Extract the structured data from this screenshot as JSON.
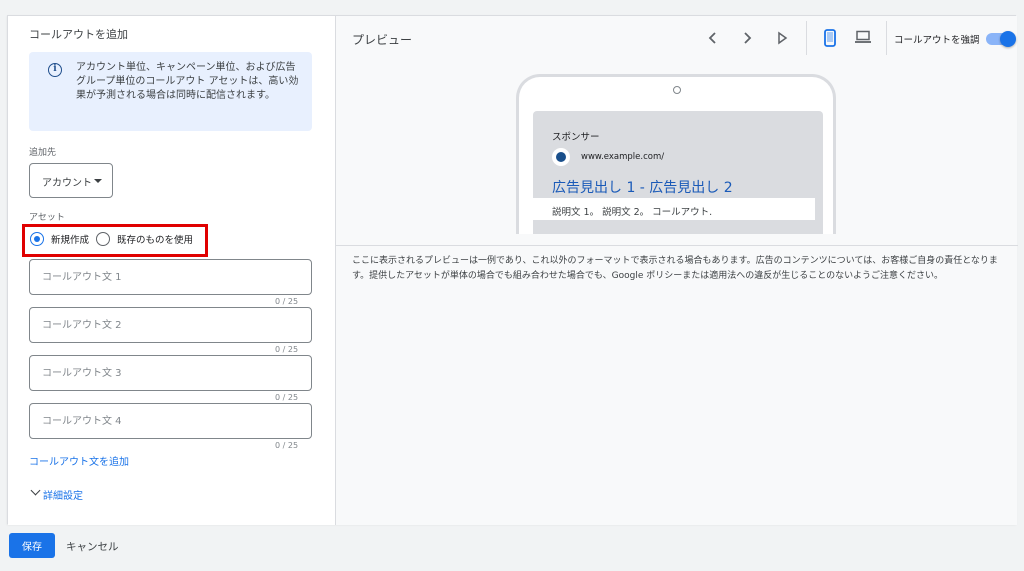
{
  "left_panel": {
    "title": "コールアウトを追加",
    "info_text": "アカウント単位、キャンペーン単位、および広告グループ単位のコールアウト アセットは、高い効果が予測される場合は同時に配信されます。",
    "add_to_label": "追加先",
    "add_to_value": "アカウント",
    "assets_label": "アセット",
    "radio_new": "新規作成",
    "radio_existing": "既存のものを使用",
    "fields": [
      {
        "placeholder": "コールアウト文 1",
        "value": "",
        "counter": "0 / 25"
      },
      {
        "placeholder": "コールアウト文 2",
        "value": "",
        "counter": "0 / 25"
      },
      {
        "placeholder": "コールアウト文 3",
        "value": "",
        "counter": "0 / 25"
      },
      {
        "placeholder": "コールアウト文 4",
        "value": "",
        "counter": "0 / 25"
      }
    ],
    "add_link": "コールアウト文を追加",
    "advanced_link": "詳細設定"
  },
  "preview": {
    "title": "プレビュー",
    "toolbar": {
      "prev_icon": "chevron-left-icon",
      "next_icon": "chevron-right-icon",
      "play_icon": "play-icon",
      "mobile_icon": "mobile-icon",
      "desktop_icon": "laptop-icon"
    },
    "highlight_toggle_label": "コールアウトを強調",
    "highlight_toggle_on": true,
    "ad": {
      "sponsor": "スポンサー",
      "url": "www.example.com/",
      "headline": "広告見出し 1 - 広告見出し 2",
      "description": "説明文 1。 説明文 2。 コールアウト."
    },
    "disclaimer": "ここに表示されるプレビューは一例であり、これ以外のフォーマットで表示される場合もあります。広告のコンテンツについては、お客様ご自身の責任となります。提供したアセットが単体の場合でも組み合わせた場合でも、Google ポリシーまたは適用法への違反が生じることのないようご注意ください。"
  },
  "footer": {
    "save_label": "保存",
    "cancel_label": "キャンセル"
  },
  "colors": {
    "accent": "#1a73e8",
    "highlight_border": "#e00000",
    "info_bg": "#e8f0fe"
  }
}
